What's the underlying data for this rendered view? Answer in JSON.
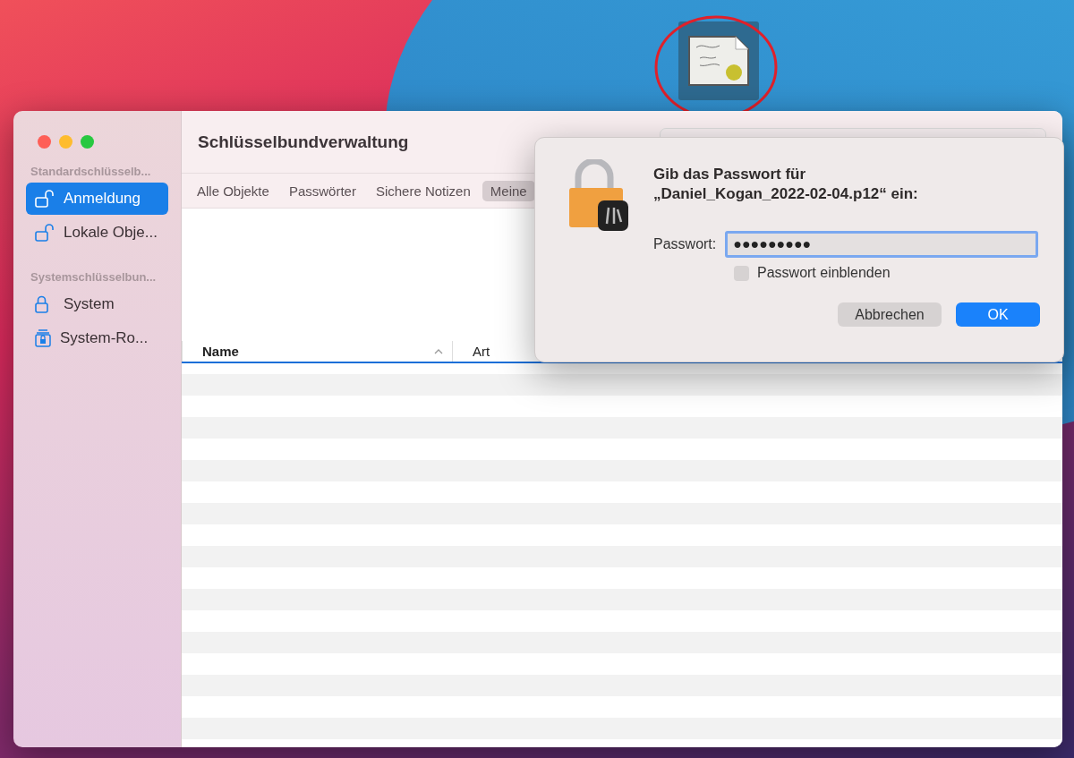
{
  "window": {
    "title": "Schlüsselbundverwaltung"
  },
  "sidebar": {
    "sections": [
      {
        "heading": "Standardschlüsselb...",
        "items": [
          {
            "label": "Anmeldung",
            "selected": true,
            "locked": false,
            "kind": "keychain"
          },
          {
            "label": "Lokale Obje...",
            "selected": false,
            "locked": false,
            "kind": "keychain"
          }
        ]
      },
      {
        "heading": "Systemschlüsselbun...",
        "items": [
          {
            "label": "System",
            "selected": false,
            "locked": true,
            "kind": "keychain"
          },
          {
            "label": "System-Ro...",
            "selected": false,
            "kind": "stack"
          }
        ]
      }
    ]
  },
  "tabs": [
    {
      "label": "Alle Objekte",
      "selected": false
    },
    {
      "label": "Passwörter",
      "selected": false
    },
    {
      "label": "Sichere Notizen",
      "selected": false
    },
    {
      "label": "Meine",
      "selected": true
    }
  ],
  "table": {
    "columns": [
      {
        "label": "Name",
        "sorted": true
      },
      {
        "label": "Art",
        "sorted": false
      }
    ]
  },
  "dialog": {
    "title": "Gib das Passwort für\n„Daniel_Kogan_2022-02-04.p12“ ein:",
    "field_label": "Passwort:",
    "value": "●●●●●●●●●",
    "checkbox": {
      "label": "Passwort einblenden",
      "checked": false
    },
    "buttons": [
      {
        "label": "Abbrechen",
        "default": false
      },
      {
        "label": "OK",
        "default": true
      }
    ]
  }
}
